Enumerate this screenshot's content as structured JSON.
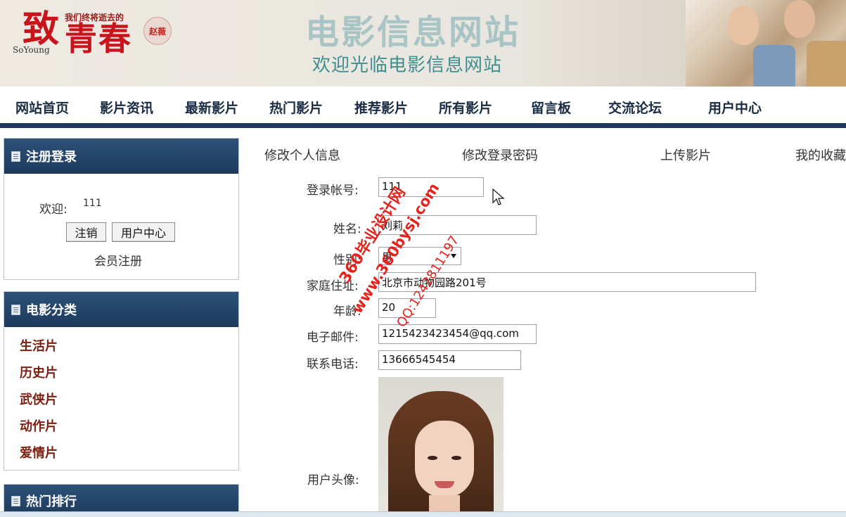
{
  "banner": {
    "logo_small": "我们终将逝去的",
    "logo_zhi": "致",
    "logo_qingchun": "青春",
    "logo_en": "SoYoung",
    "logo_seal": "赵薇",
    "site_title": "电影信息网站",
    "site_subtitle": "欢迎光临电影信息网站"
  },
  "nav": {
    "items": [
      "网站首页",
      "影片资讯",
      "最新影片",
      "热门影片",
      "推荐影片",
      "所有影片",
      "留言板",
      "交流论坛",
      "用户中心"
    ]
  },
  "sidebar": {
    "login": {
      "title": "注册登录",
      "welcome_label": "欢迎:",
      "username": "111",
      "logout_label": "注销",
      "usercenter_label": "用户中心",
      "register_label": "会员注册"
    },
    "categories": {
      "title": "电影分类",
      "items": [
        "生活片",
        "历史片",
        "武侠片",
        "动作片",
        "爱情片"
      ]
    },
    "hot": {
      "title": "热门排行"
    }
  },
  "main": {
    "tabs": [
      "修改个人信息",
      "修改登录密码",
      "上传影片",
      "我的收藏"
    ],
    "form": {
      "account_label": "登录帐号:",
      "account_value": "111",
      "name_label": "姓名:",
      "name_value": "刘莉",
      "gender_label": "性别:",
      "gender_value": "男",
      "address_label": "家庭住址:",
      "address_value": "北京市动物园路201号",
      "age_label": "年龄:",
      "age_value": "20",
      "email_label": "电子邮件:",
      "email_value": "1215423423454@qq.com",
      "phone_label": "联系电话:",
      "phone_value": "13666545454",
      "avatar_label": "用户头像:"
    }
  },
  "watermark": {
    "line1": "360毕业设计网",
    "line2": "www.360bysj.com",
    "line3": "QQ:1242811197"
  },
  "colors": {
    "nav_bar": "#1f3a5c",
    "panel_head": "#2d5179",
    "category_text": "#7b1f10",
    "watermark": "#e6221c"
  }
}
